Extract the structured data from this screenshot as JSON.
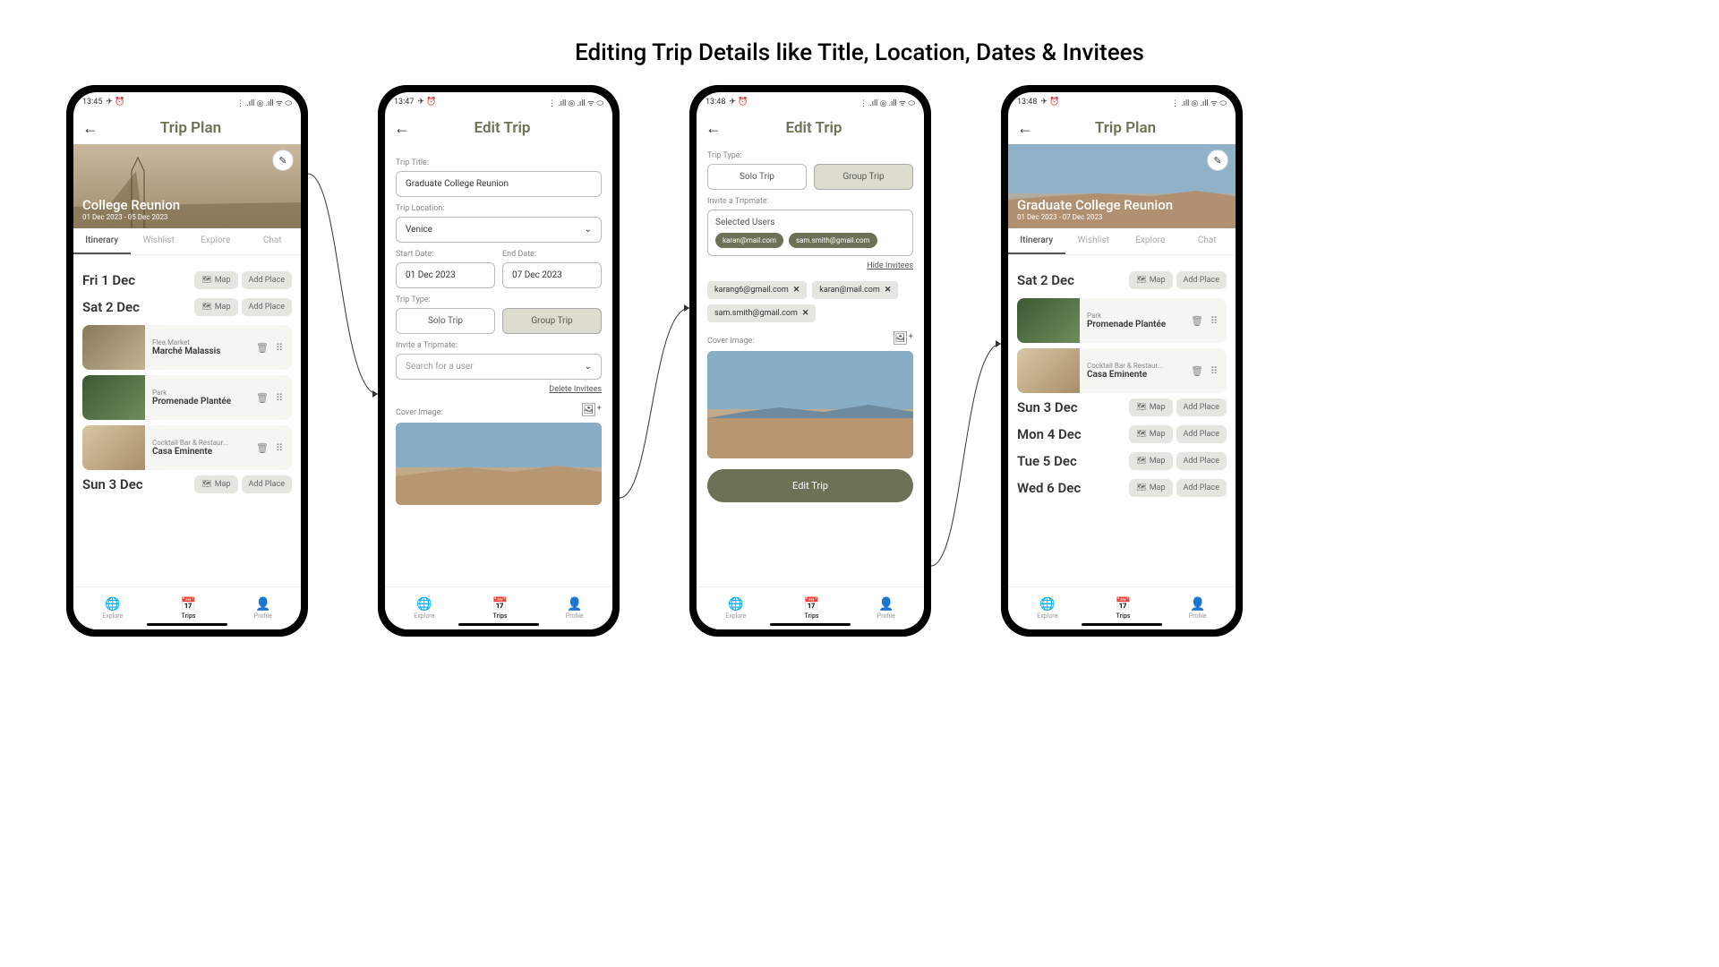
{
  "page_title": "Editing Trip Details like Title, Location, Dates & Invitees",
  "status": {
    "t1": "13:45",
    "t2": "13:47",
    "t3": "13:48",
    "t4": "13:48",
    "icons": "✈ ⏰",
    "right": "⋮ .ıll ◎ .ıll ᯤ ⬭"
  },
  "screens": [
    {
      "header": "Trip Plan",
      "hero_title": "College Reunion",
      "hero_dates": "01 Dec 2023 - 05 Dec 2023",
      "tabs": [
        "Itinerary",
        "Wishlist",
        "Explore",
        "Chat"
      ],
      "days": [
        {
          "label": "Fri 1 Dec",
          "places": []
        },
        {
          "label": "Sat 2 Dec",
          "places": [
            {
              "cat": "Flea Market",
              "name": "Marché Malassis",
              "thumb": "market"
            },
            {
              "cat": "Park",
              "name": "Promenade Plantée",
              "thumb": "green"
            },
            {
              "cat": "Cocktail Bar & Restaur...",
              "name": "Casa Eminente",
              "thumb": "cafe"
            }
          ]
        },
        {
          "label": "Sun 3 Dec",
          "places": []
        }
      ],
      "map_btn": "Map",
      "add_btn": "Add Place"
    },
    {
      "header": "Edit Trip",
      "labels": {
        "title": "Trip Title:",
        "location": "Trip Location:",
        "start": "Start Date:",
        "end": "End Date:",
        "type": "Trip Type:",
        "invite": "Invite a Tripmate:",
        "cover": "Cover Image:"
      },
      "values": {
        "title": "Graduate College Reunion",
        "location": "Venice",
        "start": "01 Dec 2023",
        "end": "07 Dec 2023",
        "search_placeholder": "Search for a user"
      },
      "type_options": [
        "Solo Trip",
        "Group Trip"
      ],
      "delete_link": "Delete Invitees"
    },
    {
      "header": "Edit Trip",
      "labels": {
        "type": "Trip Type:",
        "invite": "Invite a Tripmate:",
        "cover": "Cover Image:"
      },
      "type_options": [
        "Solo Trip",
        "Group Trip"
      ],
      "selected_users_label": "Selected Users",
      "selected_users": [
        "karan@mail.com",
        "sam.smith@gmail.com"
      ],
      "hide_link": "Hide Invitees",
      "invitee_chips": [
        "karang6@gmail.com",
        "karan@mail.com",
        "sam.smith@gmail.com"
      ],
      "submit": "Edit Trip"
    },
    {
      "header": "Trip Plan",
      "hero_title": "Graduate College Reunion",
      "hero_dates": "01 Dec 2023 - 07 Dec 2023",
      "tabs": [
        "Itinerary",
        "Wishlist",
        "Explore",
        "Chat"
      ],
      "days": [
        {
          "label": "Sat 2 Dec",
          "places": [
            {
              "cat": "Park",
              "name": "Promenade Plantée",
              "thumb": "green"
            },
            {
              "cat": "Cocktail Bar & Restaur...",
              "name": "Casa Eminente",
              "thumb": "cafe"
            }
          ]
        },
        {
          "label": "Sun 3 Dec",
          "places": []
        },
        {
          "label": "Mon 4 Dec",
          "places": []
        },
        {
          "label": "Tue 5 Dec",
          "places": []
        },
        {
          "label": "Wed 6 Dec",
          "places": []
        }
      ],
      "map_btn": "Map",
      "add_btn": "Add Place"
    }
  ],
  "nav": {
    "items": [
      "Explore",
      "Trips",
      "Profile"
    ]
  }
}
